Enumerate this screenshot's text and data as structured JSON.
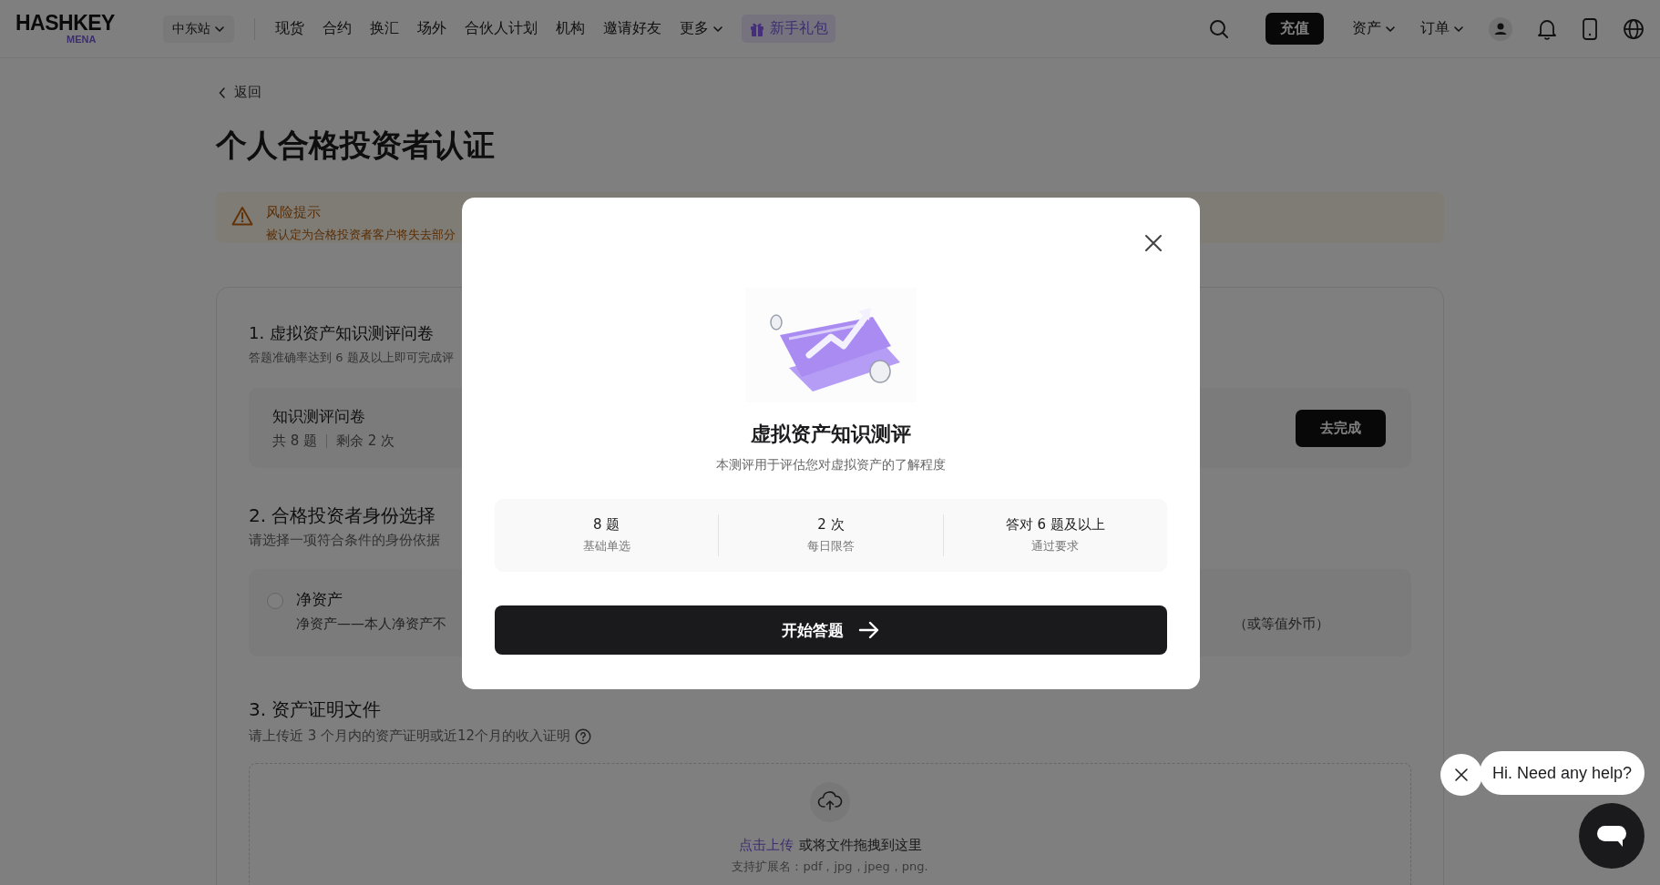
{
  "header": {
    "logo": {
      "wordmark": "HASHKEY",
      "region": "MENA"
    },
    "site_selector": "中东站",
    "nav": [
      {
        "label": "现货",
        "dropdown": false
      },
      {
        "label": "合约",
        "dropdown": false
      },
      {
        "label": "换汇",
        "dropdown": false
      },
      {
        "label": "场外",
        "dropdown": false
      },
      {
        "label": "合伙人计划",
        "dropdown": false
      },
      {
        "label": "机构",
        "dropdown": false
      },
      {
        "label": "邀请好友",
        "dropdown": false
      },
      {
        "label": "更多",
        "dropdown": true
      }
    ],
    "promo": "新手礼包",
    "deposit_button": "充值",
    "menus": [
      {
        "label": "资产"
      },
      {
        "label": "订单"
      }
    ]
  },
  "back_link": "返回",
  "title": "个人合格投资者认证",
  "risk_notice": {
    "title": "风险提示",
    "text": "被认定为合格投资者客户将失去部分"
  },
  "knowledge_section": {
    "heading": "1. 虚拟资产知识测评问卷",
    "hint": "答题准确率达到 6 题及以上即可完成评",
    "quiz": {
      "name": "知识测评问卷",
      "questions": "共 8 题",
      "remaining": "剩余 2 次",
      "action": "去完成"
    }
  },
  "identity_section": {
    "heading": "2. 合格投资者身份选择",
    "hint": "请选择一项符合条件的身份依据",
    "options": [
      {
        "title": "净资产",
        "description_start": "净资产——本人净资产不",
        "description_end": "（或等值外币）",
        "selected": false
      }
    ]
  },
  "documents_section": {
    "heading": "3. 资产证明文件",
    "hint": "请上传近 3 个月内的资产证明或近12个月的收入证明",
    "upload": {
      "link": "点击上传",
      "text": "或将文件拖拽到这里",
      "formats": "支持扩展名：pdf，jpg，jpeg，png."
    }
  },
  "modal": {
    "title": "虚拟资产知识测评",
    "subtitle": "本测评用于评估您对虚拟资产的了解程度",
    "stats": [
      {
        "value": "8 题",
        "label": "基础单选"
      },
      {
        "value": "2 次",
        "label": "每日限答"
      },
      {
        "value": "答对 6 题及以上",
        "label": "通过要求"
      }
    ],
    "start_button": "开始答题"
  },
  "chat": {
    "message": "Hi. Need any help?"
  }
}
